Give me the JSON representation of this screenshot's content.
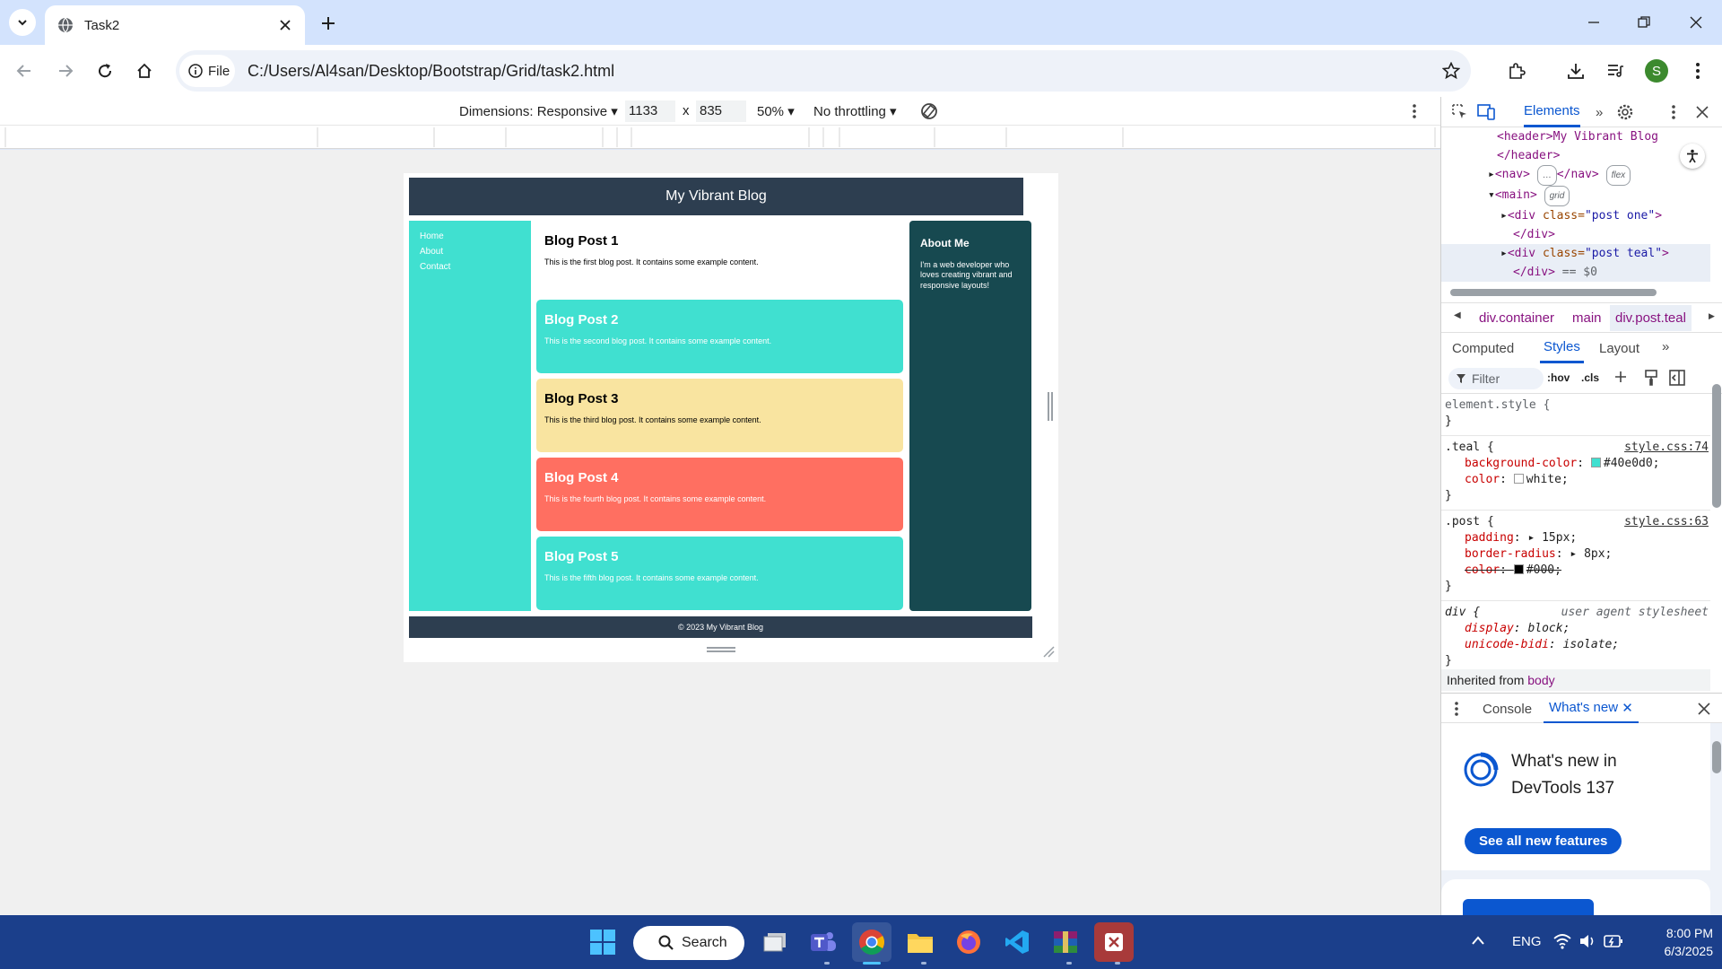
{
  "browser": {
    "tab_title": "Task2",
    "url_chip": "File",
    "url": "C:/Users/Al4san/Desktop/Bootstrap/Grid/task2.html",
    "profile_initial": "S"
  },
  "device_toolbar": {
    "dimensions_label": "Dimensions: Responsive",
    "width": "1133",
    "times": "x",
    "height": "835",
    "zoom": "50%",
    "throttling": "No throttling"
  },
  "page": {
    "header": "My Vibrant Blog",
    "nav": [
      "Home",
      "About",
      "Contact"
    ],
    "posts": [
      {
        "title": "Blog Post 1",
        "body": "This is the first blog post. It contains some example content.",
        "bg": "#ffffff",
        "fg": "#000000"
      },
      {
        "title": "Blog Post 2",
        "body": "This is the second blog post. It contains some example content.",
        "bg": "#40e0d0",
        "fg": "#ffffff"
      },
      {
        "title": "Blog Post 3",
        "body": "This is the third blog post. It contains some example content.",
        "bg": "#f9e4a0",
        "fg": "#000000"
      },
      {
        "title": "Blog Post 4",
        "body": "This is the fourth blog post. It contains some example content.",
        "bg": "#ff6f61",
        "fg": "#ffffff"
      },
      {
        "title": "Blog Post 5",
        "body": "This is the fifth blog post. It contains some example content.",
        "bg": "#40e0d0",
        "fg": "#ffffff"
      }
    ],
    "about_title": "About Me",
    "about_text": "I'm a web developer who loves creating vibrant and responsive layouts!",
    "footer": "© 2023 My Vibrant Blog"
  },
  "devtools": {
    "top_tab": "Elements",
    "dom": {
      "line1": "<header>My Vibrant Blog",
      "line2": "</header>",
      "nav_open": "<nav>",
      "nav_close": "</nav>",
      "badge_flex": "flex",
      "main_open": "<main>",
      "badge_grid": "grid",
      "div_open": "<div",
      "class_attr": "class=",
      "class_one": "\"post one\"",
      "gt": ">",
      "div_close": "</div>",
      "class_teal": "\"post teal\"",
      "selected_marker": "== $0"
    },
    "breadcrumbs": [
      "div.container",
      "main",
      "div.post.teal"
    ],
    "style_tabs": [
      "Computed",
      "Styles",
      "Layout"
    ],
    "filter_placeholder": "Filter",
    "hov": ":hov",
    "cls": ".cls",
    "rules": {
      "element_style": "element.style {",
      "close": "}",
      "teal_selector": ".teal {",
      "teal_source": "style.css:74",
      "bg_prop": "background-color",
      "bg_val": "#40e0d0;",
      "color_prop": "color",
      "color_val": "white;",
      "post_selector": ".post {",
      "post_source": "style.css:63",
      "padding_prop": "padding",
      "padding_val": "15px;",
      "radius_prop": "border-radius",
      "radius_val": "8px;",
      "color2_val": "#000;",
      "div_selector": "div {",
      "ua_label": "user agent stylesheet",
      "display_prop": "display",
      "display_val": "block;",
      "bidi_prop": "unicode-bidi",
      "bidi_val": "isolate;",
      "inherited_label": "Inherited from",
      "inherited_from": "body"
    },
    "drawer_tabs": [
      "Console",
      "What's new"
    ],
    "whats_new_title": "What's new in DevTools 137",
    "see_all_button": "See all new features"
  },
  "taskbar": {
    "search_label": "Search",
    "lang": "ENG",
    "time": "8:00 PM",
    "date": "6/3/2025"
  },
  "colors": {
    "chrome_tab_strip": "#d3e3fd",
    "blog_header": "#2d3e50",
    "teal": "#40e0d0",
    "about_bg": "#174950",
    "devtools_accent": "#0b57d0",
    "taskbar": "#1b3f8b"
  }
}
